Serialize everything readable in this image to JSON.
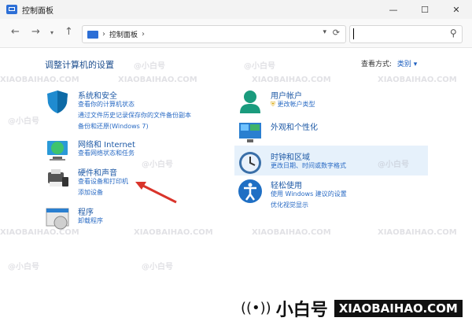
{
  "window": {
    "title": "控制面板",
    "minimize": "—",
    "maximize": "☐",
    "close": "✕"
  },
  "address": {
    "crumb": "控制面板",
    "separator": "›",
    "search_placeholder": ""
  },
  "main": {
    "title": "调整计算机的设置",
    "view_by_label": "查看方式:",
    "view_by_value": "类别",
    "categories_left": [
      {
        "name": "系统和安全",
        "subs": [
          "查看你的计算机状态",
          "通过文件历史记录保存你的文件备份副本",
          "备份和还原(Windows 7)"
        ]
      },
      {
        "name": "网络和 Internet",
        "subs": [
          "查看网络状态和任务"
        ]
      },
      {
        "name": "硬件和声音",
        "subs": [
          "查看设备和打印机",
          "添加设备"
        ]
      },
      {
        "name": "程序",
        "subs": [
          "卸载程序"
        ]
      }
    ],
    "categories_right": [
      {
        "name": "用户帐户",
        "subs": [
          "更改帐户类型"
        ]
      },
      {
        "name": "外观和个性化",
        "subs": []
      },
      {
        "name": "时钟和区域",
        "subs": [
          "更改日期、时间或数字格式"
        ]
      },
      {
        "name": "轻松使用",
        "subs": [
          "使用 Windows 建议的设置",
          "优化视觉显示"
        ]
      }
    ]
  },
  "watermark": {
    "handle": "@小白号",
    "site": "XIAOBAIHAO.COM"
  },
  "brand": {
    "name": "小白号",
    "url": "XIAOBAIHAO.COM"
  },
  "colors": {
    "link": "#1f5aa6",
    "title": "#1e4f8f",
    "highlight": "#e6f1fb",
    "arrow": "#d9342b"
  }
}
